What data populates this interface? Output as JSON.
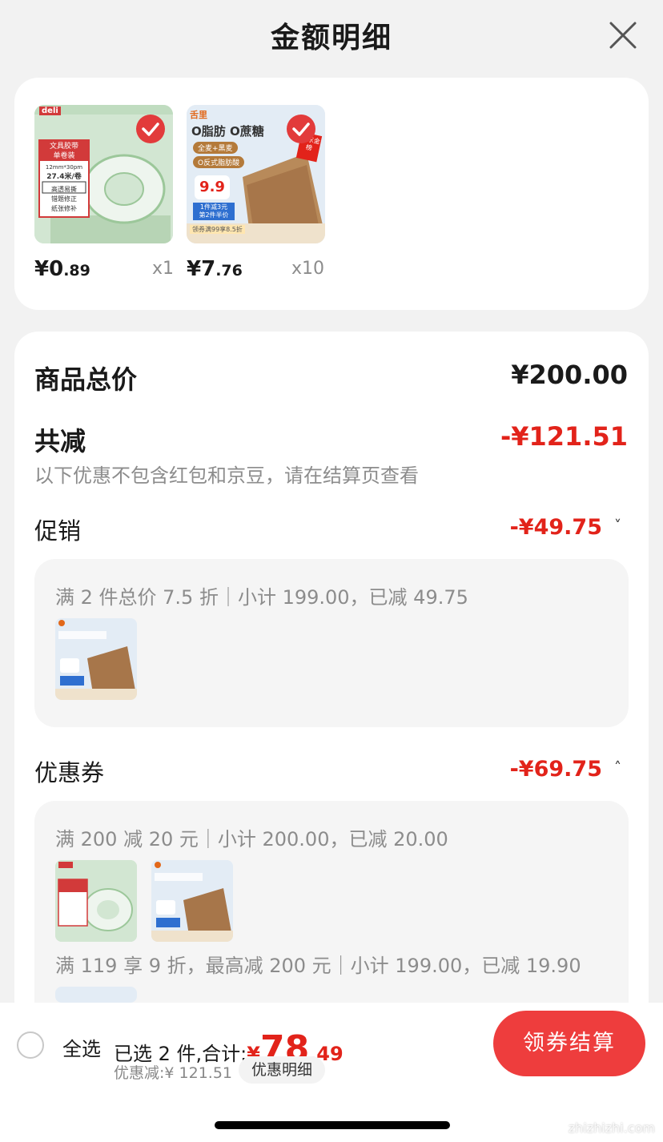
{
  "header": {
    "title": "金额明细"
  },
  "products": [
    {
      "price_int": "¥0",
      "price_dec": ".89",
      "qty": "x1",
      "brand": "deli",
      "tag_lines": [
        "文具胶带",
        "单卷装",
        "12mm*30pm",
        "27.4米/卷",
        "高透易撕",
        "错题修正",
        "纸张修补"
      ]
    },
    {
      "price_int": "¥7",
      "price_dec": ".76",
      "qty": "x10",
      "brand": "舌里",
      "headline": "O脂肪 O蔗糖",
      "chips": [
        "全麦+黑麦",
        "O反式脂肪酸"
      ],
      "price_tag": "9.9",
      "badge": "京东金榜",
      "promo": [
        "1件减3元",
        "第2件半价"
      ],
      "footer": "领券满99享8.5折"
    }
  ],
  "summary": {
    "total_label": "商品总价",
    "total_value": "¥200.00",
    "reduce_label": "共减",
    "reduce_value": "-¥121.51",
    "note": "以下优惠不包含红包和京豆，请在结算页查看"
  },
  "promotion": {
    "label": "促销",
    "value": "-¥49.75",
    "chevron": "˅",
    "desc": "满 2 件总价 7.5 折｜小计 199.00，已减 49.75"
  },
  "coupon": {
    "label": "优惠券",
    "value": "-¥69.75",
    "chevron": "˄",
    "desc1": "满 200 减 20 元｜小计 200.00，已减 20.00",
    "desc2": "满 119 享 9 折，最高减 200 元｜小计 199.00，已减 19.90"
  },
  "bottom": {
    "select_all": "全选",
    "selected_text": "已选 2 件,合计:",
    "total_cur": "¥",
    "total_int": "78",
    "total_dec": ".49",
    "discount": "优惠减:¥ 121.51",
    "detail_link": "优惠明细",
    "checkout": "领券结算"
  },
  "watermark": "zhizhizhi.com",
  "colors": {
    "accent": "#e2231a",
    "button": "#ee3d3d"
  }
}
